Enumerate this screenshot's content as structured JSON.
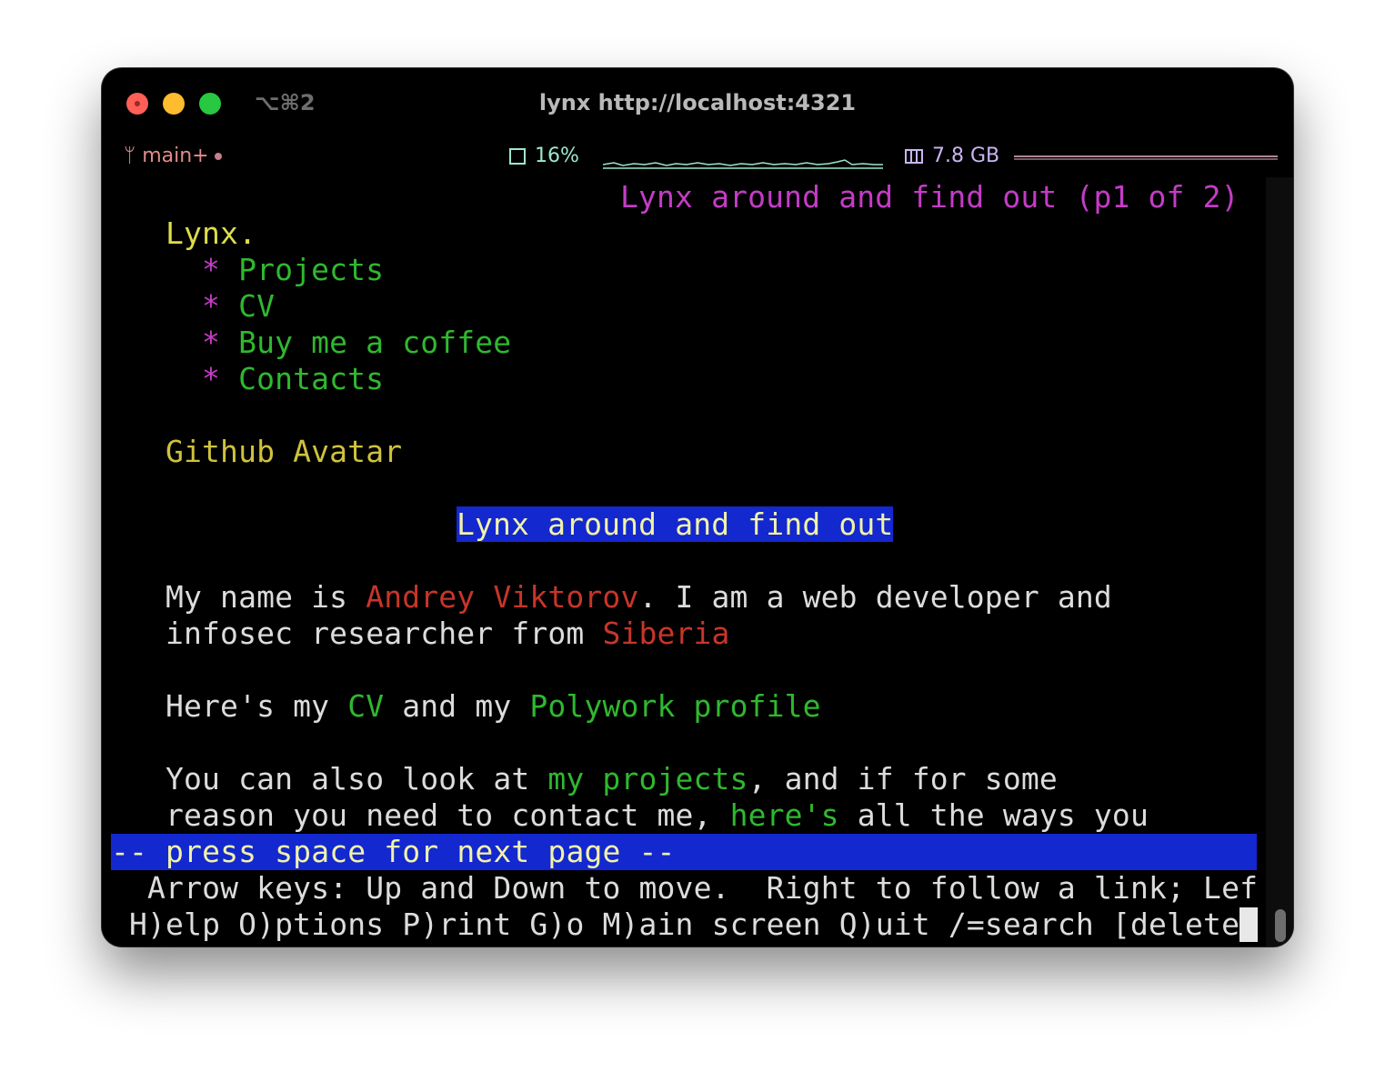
{
  "window": {
    "shortcut": "⌥⌘2",
    "title": "lynx http://localhost:4321"
  },
  "status": {
    "branch": "main+",
    "branch_icon": "git-branch-icon",
    "cpu": "16%",
    "cpu_icon": "cpu-chip-icon",
    "memory": "7.8 GB",
    "memory_icon": "ram-icon"
  },
  "colors": {
    "link": "#2fb82f",
    "bullet": "#c43cc6",
    "emphasis": "#c8352a",
    "highlight_bg": "#1328cf",
    "highlight_fg": "#f2f2a8"
  },
  "page": {
    "header": "Lynx around and find out (p1 of 2)",
    "site_title": "Lynx.",
    "bullet": "*",
    "nav": [
      "Projects",
      "CV",
      "Buy me a coffee",
      "Contacts"
    ],
    "avatar_alt": "Github Avatar",
    "heading": "Lynx around and find out",
    "intro": {
      "p1": "My name is ",
      "name": "Andrey Viktorov",
      "p2": ". I am a web developer and",
      "p3": "infosec researcher from ",
      "place": "Siberia"
    },
    "cv_line": {
      "p1": "Here's my ",
      "cv": "CV",
      "p2": " and my ",
      "polywork": "Polywork profile"
    },
    "projects_line": {
      "p1": "You can also look at ",
      "projects": "my projects",
      "p2": ", and if for some",
      "p3": "reason you need to contact me, ",
      "here": "here's",
      "p4": " all the ways you"
    }
  },
  "footer": {
    "more": "-- press space for next page --",
    "help1": "  Arrow keys: Up and Down to move.  Right to follow a link; Lef",
    "help2": " H)elp O)ptions P)rint G)o M)ain screen Q)uit /=search [delete"
  }
}
